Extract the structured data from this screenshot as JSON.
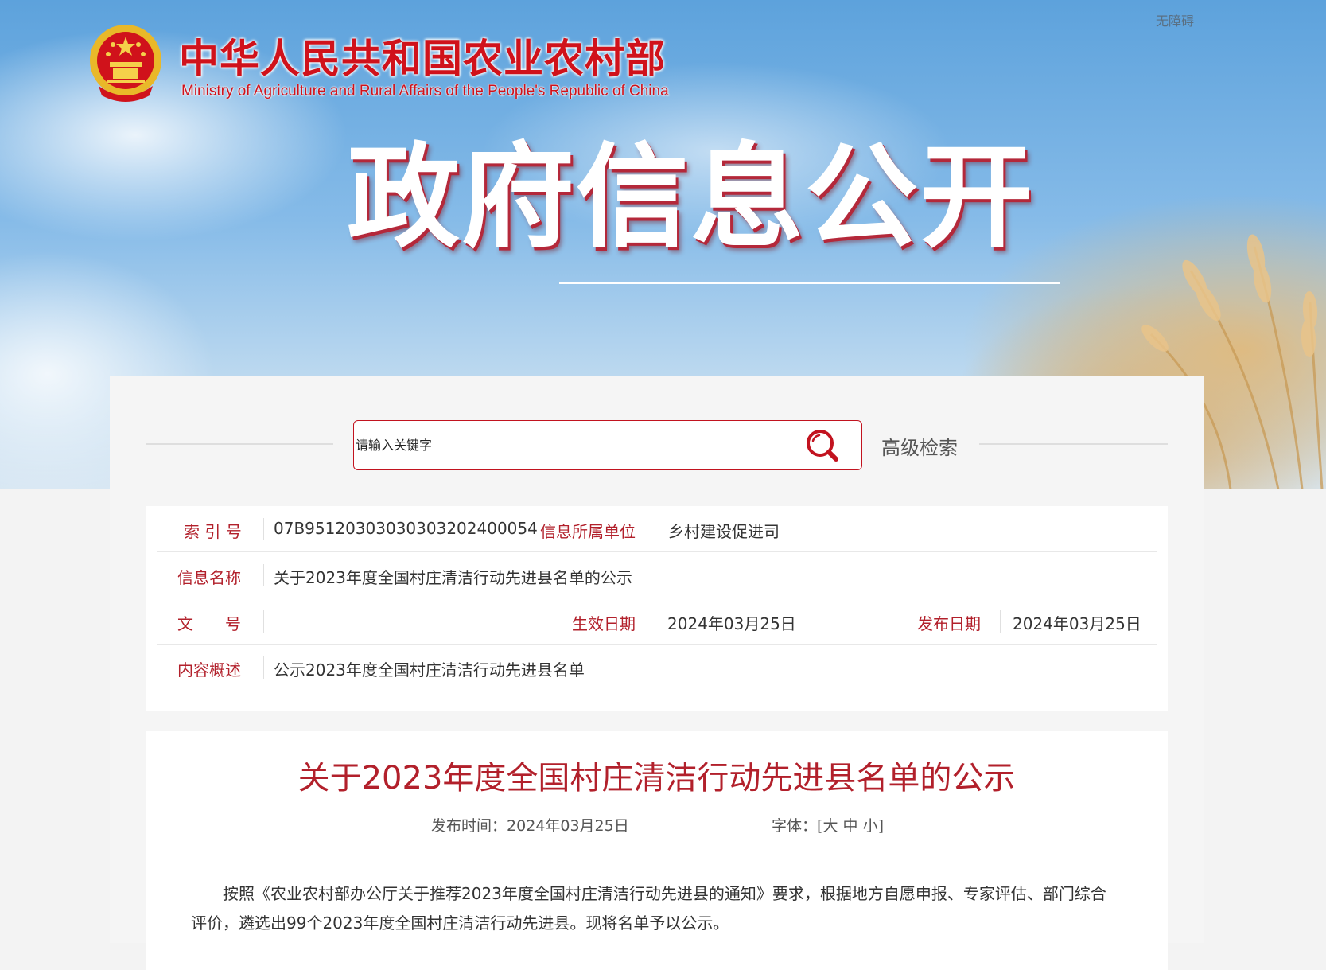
{
  "header": {
    "site_title_cn": "中华人民共和国农业农村部",
    "site_title_en": "Ministry of Agriculture and Rural Affairs of the People's Republic of China",
    "accessibility_link": "无障碍",
    "hero_text": "政府信息公开",
    "emblem_icon": "national-emblem-icon"
  },
  "search": {
    "placeholder": "请输入关键字",
    "value": "",
    "advanced_label": "高级检索",
    "icon": "search-icon"
  },
  "meta": {
    "index_label": "索 引 号",
    "index_value": "07B951203030303032024000​54",
    "unit_label": "信息所属单位",
    "unit_value": "乡村建设促进司",
    "name_label": "信息名称",
    "name_value": "关于2023年度全国村庄清洁行动先进县名单的公示",
    "docno_label": "文　　号",
    "docno_value": "",
    "effective_label": "生效日期",
    "effective_value": "2024年03月25日",
    "publish_label": "发布日期",
    "publish_value": "2024年03月25日",
    "summary_label": "内容概述",
    "summary_value": "公示2023年度全国村庄清洁行动先进县名单"
  },
  "article": {
    "title": "关于2023年度全国村庄清洁行动先进县名单的公示",
    "publish_time_label": "发布时间：",
    "publish_time_value": "2024年03月25日",
    "font_label": "字体：",
    "font_open": "[",
    "font_large": "大",
    "font_medium": "中",
    "font_small": "小",
    "font_close": "]",
    "paragraph": "按照《农业农村部办公厅关于推荐2023年度全国村庄清洁行动先进县的通知》要求，根据地方自愿申报、专家评估、部门综合评价，遴选出99个2023年度全国村庄清洁行动先进县。现将名单予以公示。"
  },
  "colors": {
    "brand_red": "#d0121b",
    "label_red": "#b2202b",
    "sky_blue": "#5da2dc"
  }
}
